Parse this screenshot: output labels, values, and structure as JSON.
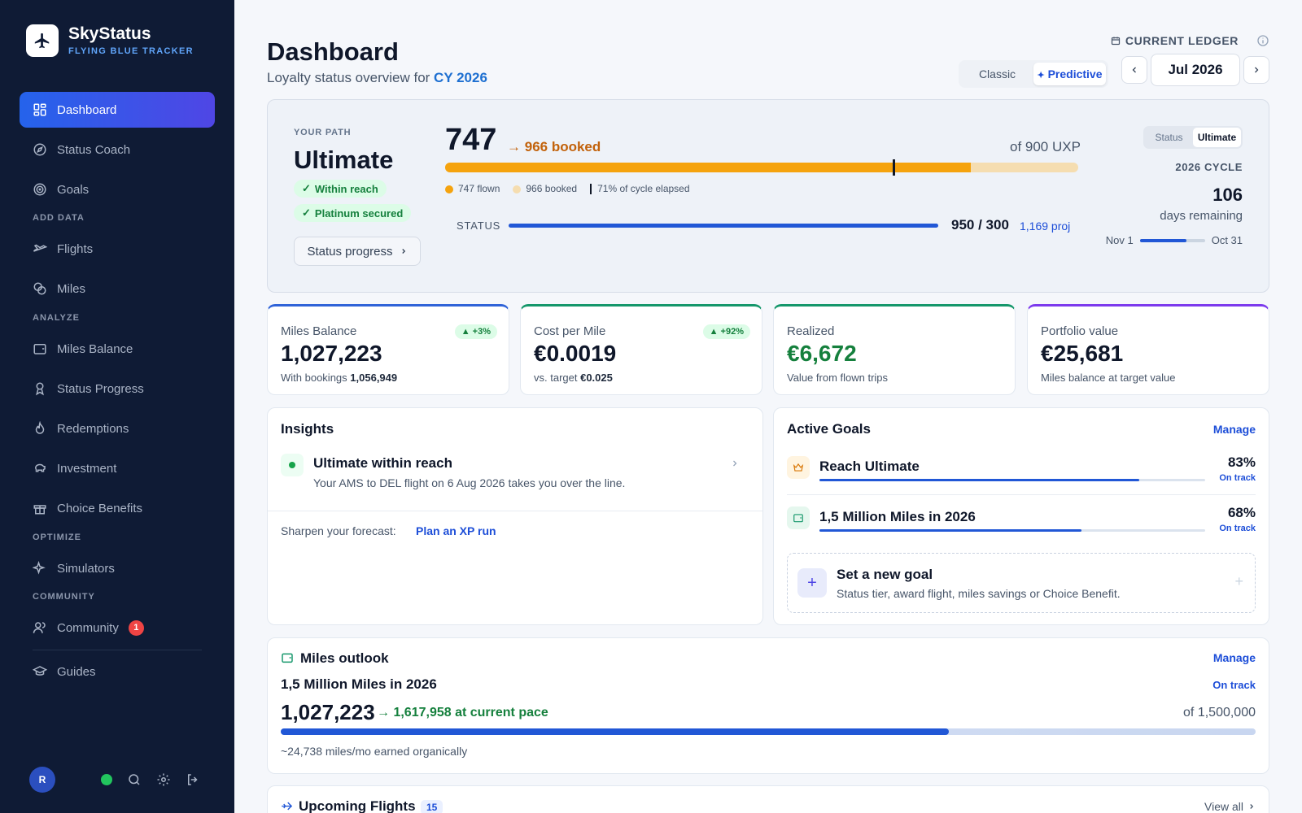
{
  "brand": {
    "title": "SkyStatus",
    "subtitle": "FLYING BLUE TRACKER"
  },
  "sidebar": {
    "items": [
      {
        "label": "Dashboard",
        "icon": "grid-icon"
      },
      {
        "label": "Status Coach",
        "icon": "compass-icon"
      },
      {
        "label": "Goals",
        "icon": "target-icon"
      },
      {
        "label": "Flights",
        "icon": "plane-icon"
      },
      {
        "label": "Miles",
        "icon": "coins-icon"
      },
      {
        "label": "Miles Balance",
        "icon": "wallet-icon"
      },
      {
        "label": "Status Progress",
        "icon": "award-icon"
      },
      {
        "label": "Redemptions",
        "icon": "flame-icon"
      },
      {
        "label": "Investment",
        "icon": "piggy-bank-icon"
      },
      {
        "label": "Choice Benefits",
        "icon": "gift-icon"
      },
      {
        "label": "Simulators",
        "icon": "sparkles-icon"
      },
      {
        "label": "Community",
        "icon": "users-icon",
        "badge": "1"
      },
      {
        "label": "Guides",
        "icon": "graduation-cap-icon"
      }
    ],
    "sections": [
      "ADD DATA",
      "ANALYZE",
      "OPTIMIZE",
      "COMMUNITY"
    ],
    "avatar": "R"
  },
  "header": {
    "title": "Dashboard",
    "subtitle_prefix": "Loyalty status overview for",
    "subtitle_year": "CY 2026",
    "ledger_label": "CURRENT LEDGER",
    "view_options": [
      "Classic",
      "Predictive"
    ],
    "selected_view": "Predictive",
    "month": "Jul 2026"
  },
  "hero": {
    "path_label": "YOUR PATH",
    "path_name": "Ultimate",
    "pill_reach": "Within reach",
    "pill_secured": "Platinum secured",
    "status_progress_btn": "Status progress",
    "xp_flown": "747",
    "xp_booked": "966 booked",
    "xp_target": "of 900 UXP",
    "legend_flown": "747 flown",
    "legend_booked": "966 booked",
    "legend_elapsed": "71% of cycle elapsed",
    "flown_fraction": 0.83,
    "booked_fraction": 1.0,
    "elapsed_fraction": 0.71,
    "status_label": "STATUS",
    "status_value": "950 / 300",
    "status_proj": "1,169 proj",
    "toggle": [
      "Status",
      "Ultimate"
    ],
    "toggle_selected": "Ultimate",
    "cycle_label": "2026 CYCLE",
    "days_remaining": "106",
    "days_label": "days remaining",
    "cycle_start": "Nov 1",
    "cycle_end": "Oct 31",
    "cycle_fraction": 0.71,
    "colors": {
      "flown": "#f5a30e",
      "booked": "#f5ddb0",
      "status": "#2157d6"
    }
  },
  "kpis": [
    {
      "label": "Miles Balance",
      "value": "1,027,223",
      "sub_prefix": "With bookings",
      "sub_value": "1,056,949",
      "badge": "+3%",
      "accent": "#2f63d8"
    },
    {
      "label": "Cost per Mile",
      "value": "€0.0019",
      "sub_prefix": "vs. target",
      "sub_value": "€0.025",
      "badge": "+92%",
      "accent": "#15976b"
    },
    {
      "label": "Realized",
      "value": "€6,672",
      "sub_prefix": "Value from flown trips",
      "sub_value": "",
      "badge": "",
      "accent": "#15976b"
    },
    {
      "label": "Portfolio value",
      "value": "€25,681",
      "sub_prefix": "Miles balance at target value",
      "sub_value": "",
      "badge": "",
      "accent": "#7c3aed"
    }
  ],
  "insights": {
    "title": "Insights",
    "item_title": "Ultimate within reach",
    "item_body": "Your AMS to DEL flight on 6 Aug 2026 takes you over the line.",
    "sharpen_label": "Sharpen your forecast:",
    "sharpen_link": "Plan an XP run"
  },
  "goals": {
    "title": "Active Goals",
    "manage": "Manage",
    "items": [
      {
        "title": "Reach Ultimate",
        "pct": "83%",
        "progress": 0.83,
        "state": "On track",
        "icon": "crown-icon"
      },
      {
        "title": "1,5 Million Miles in 2026",
        "pct": "68%",
        "progress": 0.68,
        "state": "On track",
        "icon": "wallet-icon"
      }
    ],
    "new_goal_title": "Set a new goal",
    "new_goal_sub": "Status tier, award flight, miles savings or Choice Benefit."
  },
  "outlook": {
    "title": "Miles outlook",
    "manage": "Manage",
    "goal": "1,5 Million Miles in 2026",
    "state": "On track",
    "current": "1,027,223",
    "pace": "1,617,958 at current pace",
    "target": "of 1,500,000",
    "progress": 0.685,
    "note": "~24,738 miles/mo earned organically"
  },
  "upcoming": {
    "title": "Upcoming Flights",
    "count": "15",
    "view_all": "View all"
  }
}
